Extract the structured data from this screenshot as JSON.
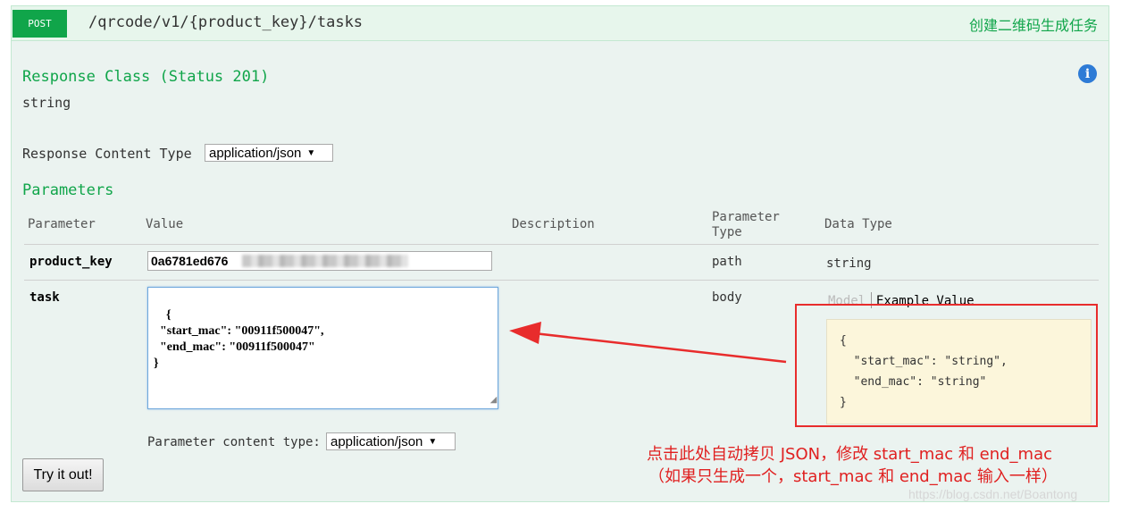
{
  "operation": {
    "method": "POST",
    "path": "/qrcode/v1/{product_key}/tasks",
    "summary": "创建二维码生成任务"
  },
  "response_class": {
    "title": "Response Class (Status 201)",
    "type": "string",
    "info_icon": "info-icon"
  },
  "response_content_type": {
    "label": "Response Content Type",
    "selected": "application/json"
  },
  "parameters": {
    "title": "Parameters",
    "headers": [
      "Parameter",
      "Value",
      "Description",
      "Parameter Type",
      "Data Type"
    ],
    "rows": [
      {
        "name": "product_key",
        "value": "0a6781ed676",
        "param_type": "path",
        "data_type": "string"
      },
      {
        "name": "task",
        "value": "{\n  \"start_mac\": \"00911f500047\",\n  \"end_mac\": \"00911f500047\"\n}",
        "param_type": "body"
      }
    ],
    "model_tab": "Model",
    "example_tab": "Example Value",
    "example_value": "{\n  \"start_mac\": \"string\",\n  \"end_mac\": \"string\"\n}",
    "content_type_label": "Parameter content type:",
    "content_type_selected": "application/json"
  },
  "try_button": "Try it out!",
  "annotation": {
    "line1": "点击此处自动拷贝 JSON，修改 start_mac 和 end_mac",
    "line2": "（如果只生成一个，start_mac 和 end_mac 输入一样）",
    "color": "#e02020"
  },
  "watermark": "https://blog.csdn.net/Boantong"
}
